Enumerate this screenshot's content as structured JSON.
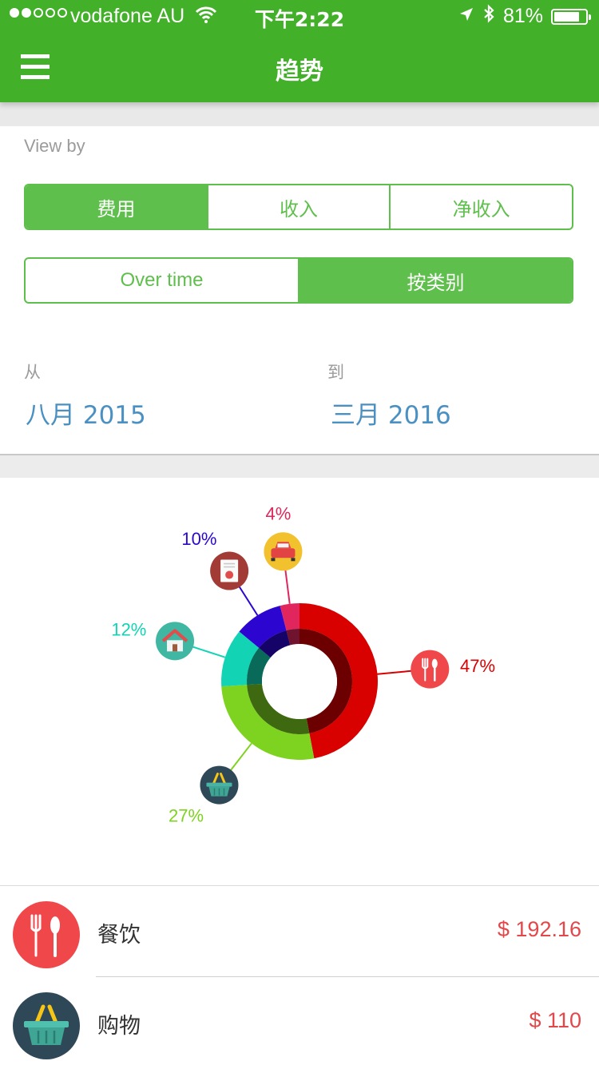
{
  "status": {
    "carrier": "vodafone AU",
    "time": "下午2:22",
    "battery": "81%"
  },
  "header": {
    "title": "趋势"
  },
  "viewby": {
    "label": "View by"
  },
  "type_tabs": [
    {
      "label": "费用",
      "active": true
    },
    {
      "label": "收入",
      "active": false
    },
    {
      "label": "净收入",
      "active": false
    }
  ],
  "mode_tabs": [
    {
      "label": "Over time",
      "active": false
    },
    {
      "label": "按类别",
      "active": true
    }
  ],
  "range": {
    "from_label": "从",
    "from_value": "八月 2015",
    "to_label": "到",
    "to_value": "三月 2016"
  },
  "chart_data": {
    "type": "pie",
    "slices": [
      {
        "label": "47%",
        "value": 47,
        "color": "#d90000",
        "icon": "fork-spoon-icon"
      },
      {
        "label": "27%",
        "value": 27,
        "color": "#7ed321",
        "icon": "basket-icon"
      },
      {
        "label": "12%",
        "value": 12,
        "color": "#12d4b4",
        "icon": "house-icon"
      },
      {
        "label": "10%",
        "value": 10,
        "color": "#2c06d0",
        "icon": "bill-icon"
      },
      {
        "label": "4%",
        "value": 4,
        "color": "#e0265c",
        "icon": "car-icon"
      }
    ]
  },
  "categories": [
    {
      "name": "餐饮",
      "amount": "$ 192.16",
      "icon": "fork-spoon-icon",
      "color": "#f0474b"
    },
    {
      "name": "购物",
      "amount": "$ 110",
      "icon": "basket-icon",
      "color": "#2f4858"
    }
  ]
}
